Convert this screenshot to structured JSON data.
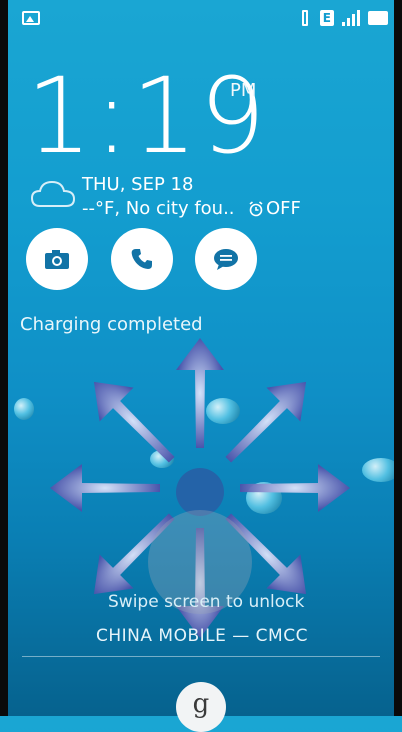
{
  "status_bar": {
    "network_type": "E"
  },
  "clock": {
    "time": "1:19",
    "ampm": "PM"
  },
  "weather": {
    "date": "THU, SEP 18",
    "temp_city": "--°F, No city fou..",
    "alarm": "OFF"
  },
  "shortcuts": [
    {
      "name": "camera",
      "icon": "camera-icon"
    },
    {
      "name": "phone",
      "icon": "phone-icon"
    },
    {
      "name": "messages",
      "icon": "message-icon"
    }
  ],
  "status_message": "Charging completed",
  "unlock": {
    "hint": "Swipe screen to unlock"
  },
  "carrier": "CHINA MOBILE — CMCC",
  "google_button": "g",
  "colors": {
    "accent": "#139dcf",
    "arrow": "#5a5fb0",
    "center_dot": "#2463a8"
  }
}
